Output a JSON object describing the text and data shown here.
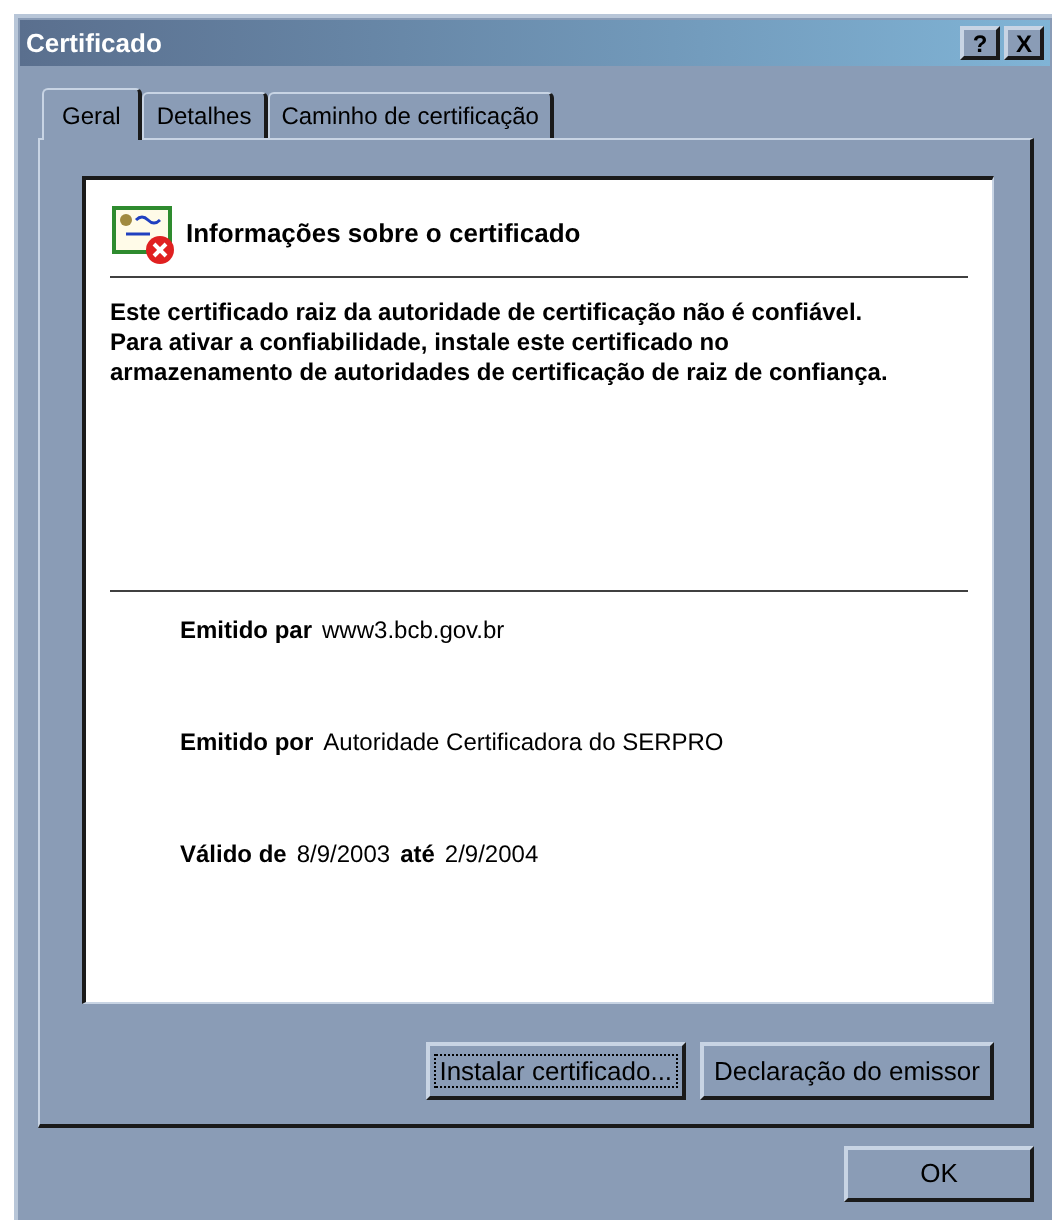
{
  "window": {
    "title": "Certificado",
    "controls": [
      "?",
      "X"
    ]
  },
  "tabs": [
    {
      "label": "Geral",
      "selected": true
    },
    {
      "label": "Detalhes",
      "selected": false
    },
    {
      "label": "Caminho de certificação",
      "selected": false
    }
  ],
  "info": {
    "heading": "Informações sobre o certificado",
    "message": "Este certificado raiz da autoridade de certificação não é confiável. Para ativar a confiabilidade, instale este certificado no armazenamento de autoridades de certificação de raiz de confiança."
  },
  "fields": [
    {
      "parts": [
        {
          "text": "Emitido par",
          "bold": true
        },
        {
          "text": "www3.bcb.gov.br",
          "bold": false
        }
      ]
    },
    {
      "parts": [
        {
          "text": "Emitido por",
          "bold": true
        },
        {
          "text": "Autoridade Certificadora do SERPRO",
          "bold": false
        }
      ]
    },
    {
      "parts": [
        {
          "text": "Válido de",
          "bold": true
        },
        {
          "text": "8/9/2003",
          "bold": false
        },
        {
          "text": "até",
          "bold": true
        },
        {
          "text": "2/9/2004",
          "bold": false
        }
      ]
    }
  ],
  "panel_buttons": [
    {
      "label": "Instalar certificado...",
      "focused": true
    },
    {
      "label": "Declaração do emissor",
      "focused": false
    }
  ],
  "buttons": [
    "OK"
  ]
}
